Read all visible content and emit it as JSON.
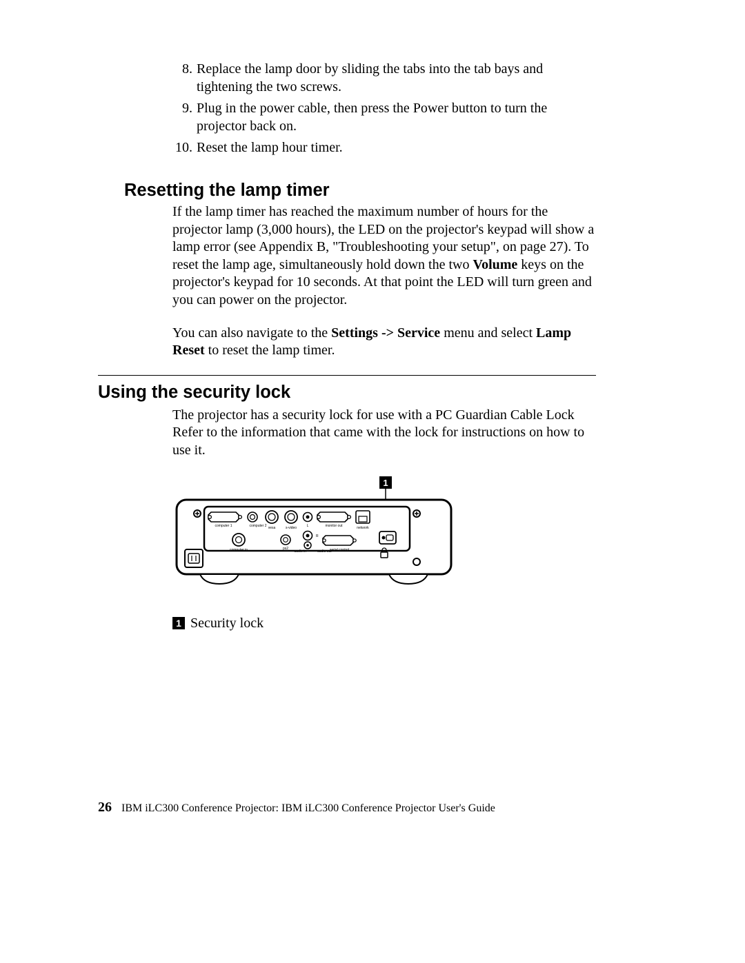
{
  "steps": [
    "Replace the lamp door by sliding the tabs into the tab bays and tightening the two screws.",
    "Plug in the power cable, then press the Power button to turn the projector back on.",
    "Reset the lamp hour timer."
  ],
  "section_reset": {
    "heading": "Resetting the lamp timer",
    "para1_a": "If the lamp timer has reached the maximum number of hours for the projector lamp (3,000 hours), the LED on the projector's keypad will show a lamp error (see Appendix B, \"Troubleshooting your setup\", on page 27). To reset the lamp age, simultaneously hold down the two ",
    "para1_bold1": "Volume",
    "para1_b": " keys on the projector's keypad for 10 seconds. At that point the LED will turn green and you can power on the projector.",
    "para2_a": "You can also navigate to the ",
    "para2_bold1": "Settings -> Service",
    "para2_b": " menu and select ",
    "para2_bold2": "Lamp Reset",
    "para2_c": " to reset the lamp timer."
  },
  "section_lock": {
    "heading": "Using the security lock",
    "para": "The projector has a security lock for use with a PC Guardian Cable Lock Refer to the information that came with the lock for instructions on how to use it."
  },
  "callout": {
    "num": "1",
    "label": "Security lock"
  },
  "diagram_labels": {
    "computer1": "computer 1",
    "computer2": "computer 2",
    "computer_in": "computer in",
    "svideo": "s-video",
    "vesa": "vesa",
    "L": "L",
    "R": "R",
    "audio_in": "audio in",
    "monitor_out": "monitor out",
    "network": "network",
    "ps2": "ps2",
    "audio_out": "audio out",
    "serial_control": "serial control"
  },
  "footer": {
    "page": "26",
    "text": "IBM iLC300 Conference Projector: IBM iLC300 Conference Projector User's Guide"
  }
}
